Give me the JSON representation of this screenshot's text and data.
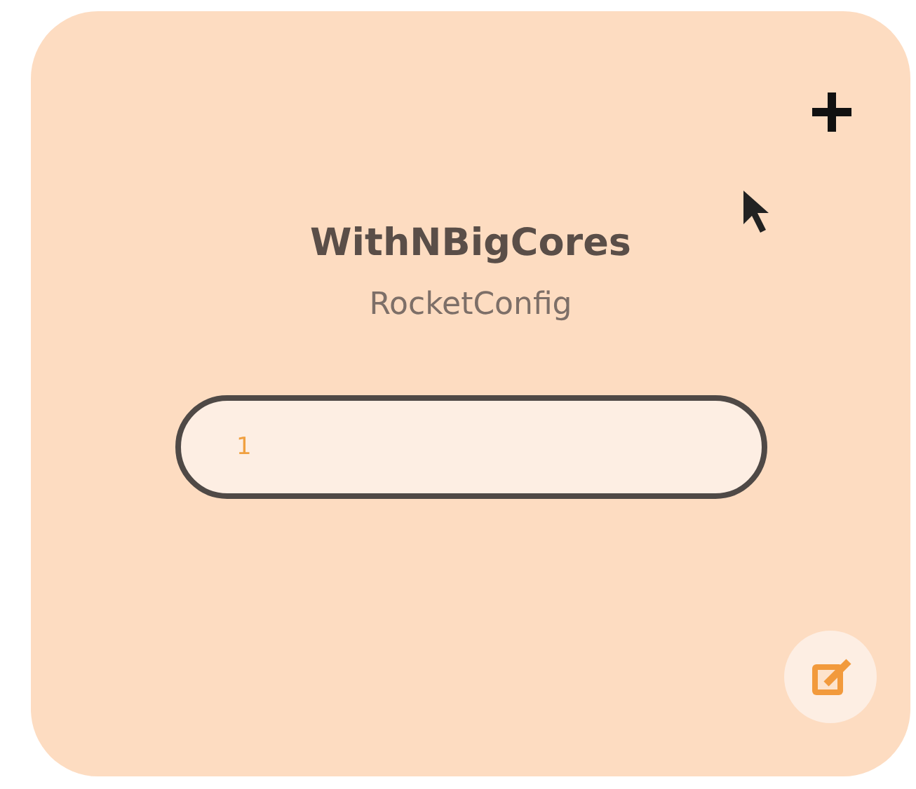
{
  "card": {
    "title": "WithNBigCores",
    "subtitle": "RocketConfig",
    "input": {
      "value": "1"
    }
  }
}
